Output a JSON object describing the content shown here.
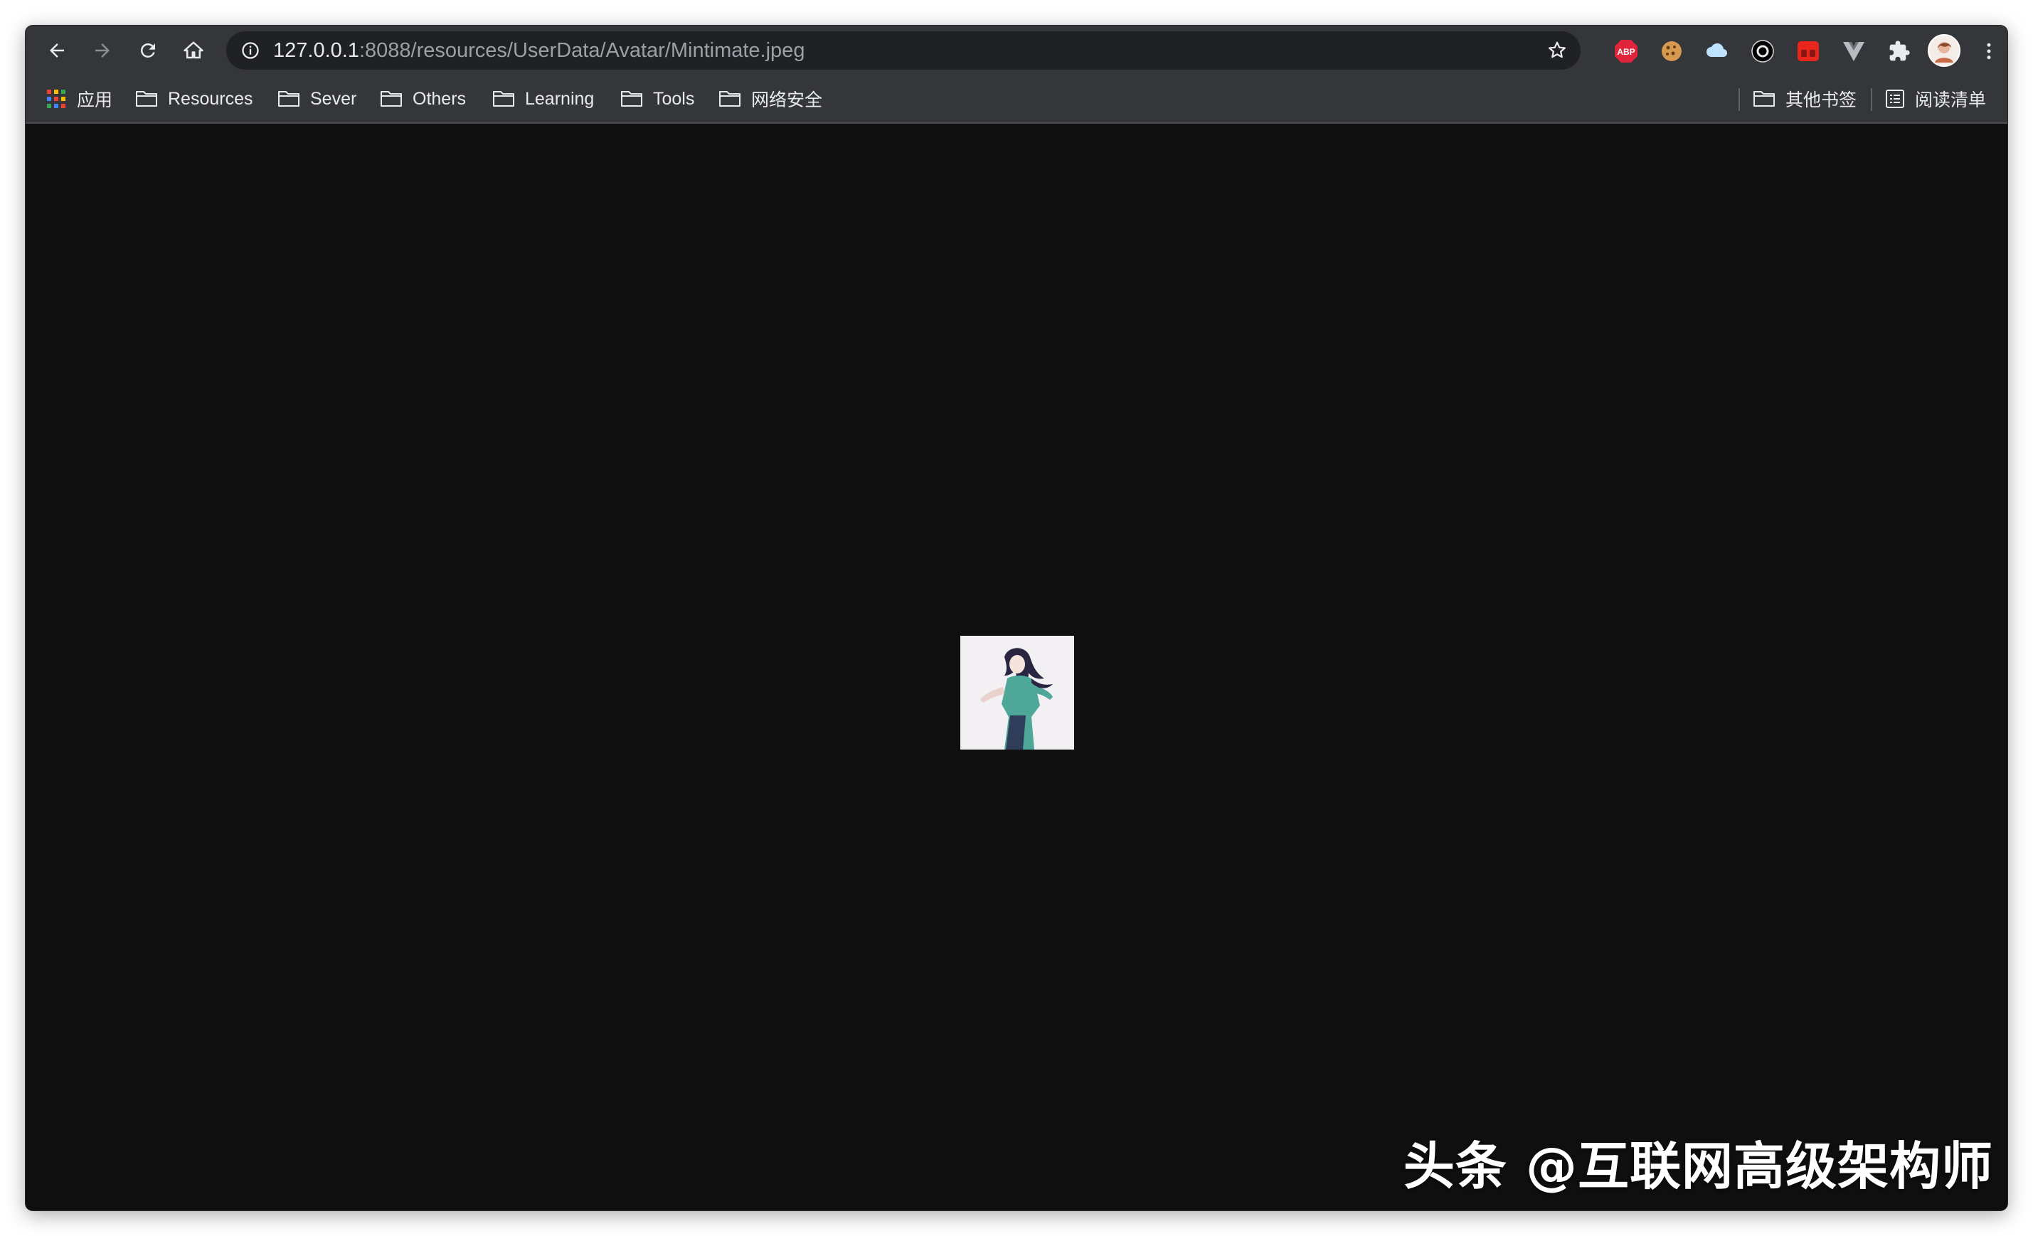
{
  "browser": {
    "url": {
      "host": "127.0.0.1",
      "path": ":8088/resources/UserData/Avatar/Mintimate.jpeg"
    },
    "nav": {
      "back_icon": "arrow-left-icon",
      "forward_icon": "arrow-right-icon",
      "reload_icon": "reload-icon",
      "home_icon": "home-icon"
    },
    "extensions": [
      "adblock-plus-icon",
      "cookie-icon",
      "cloud-icon",
      "record-icon",
      "red-extension-icon",
      "vue-devtools-icon",
      "puzzle-icon",
      "profile-avatar",
      "menu-kebab-icon"
    ],
    "adblock_label": "ABP"
  },
  "bookmarks": {
    "apps_label": "应用",
    "items": [
      "Resources",
      "Sever",
      "Others",
      "Learning",
      "Tools",
      "网络安全"
    ],
    "other_label": "其他书签",
    "reading_list_label": "阅读清单"
  },
  "page": {
    "image_subject": "anime avatar image",
    "watermark": "头条 @互联网高级架构师"
  },
  "colors": {
    "toolbar": "#35363a",
    "omnibox": "#202124",
    "content_bg": "#0f0f10",
    "abp_red": "#e0243a"
  }
}
